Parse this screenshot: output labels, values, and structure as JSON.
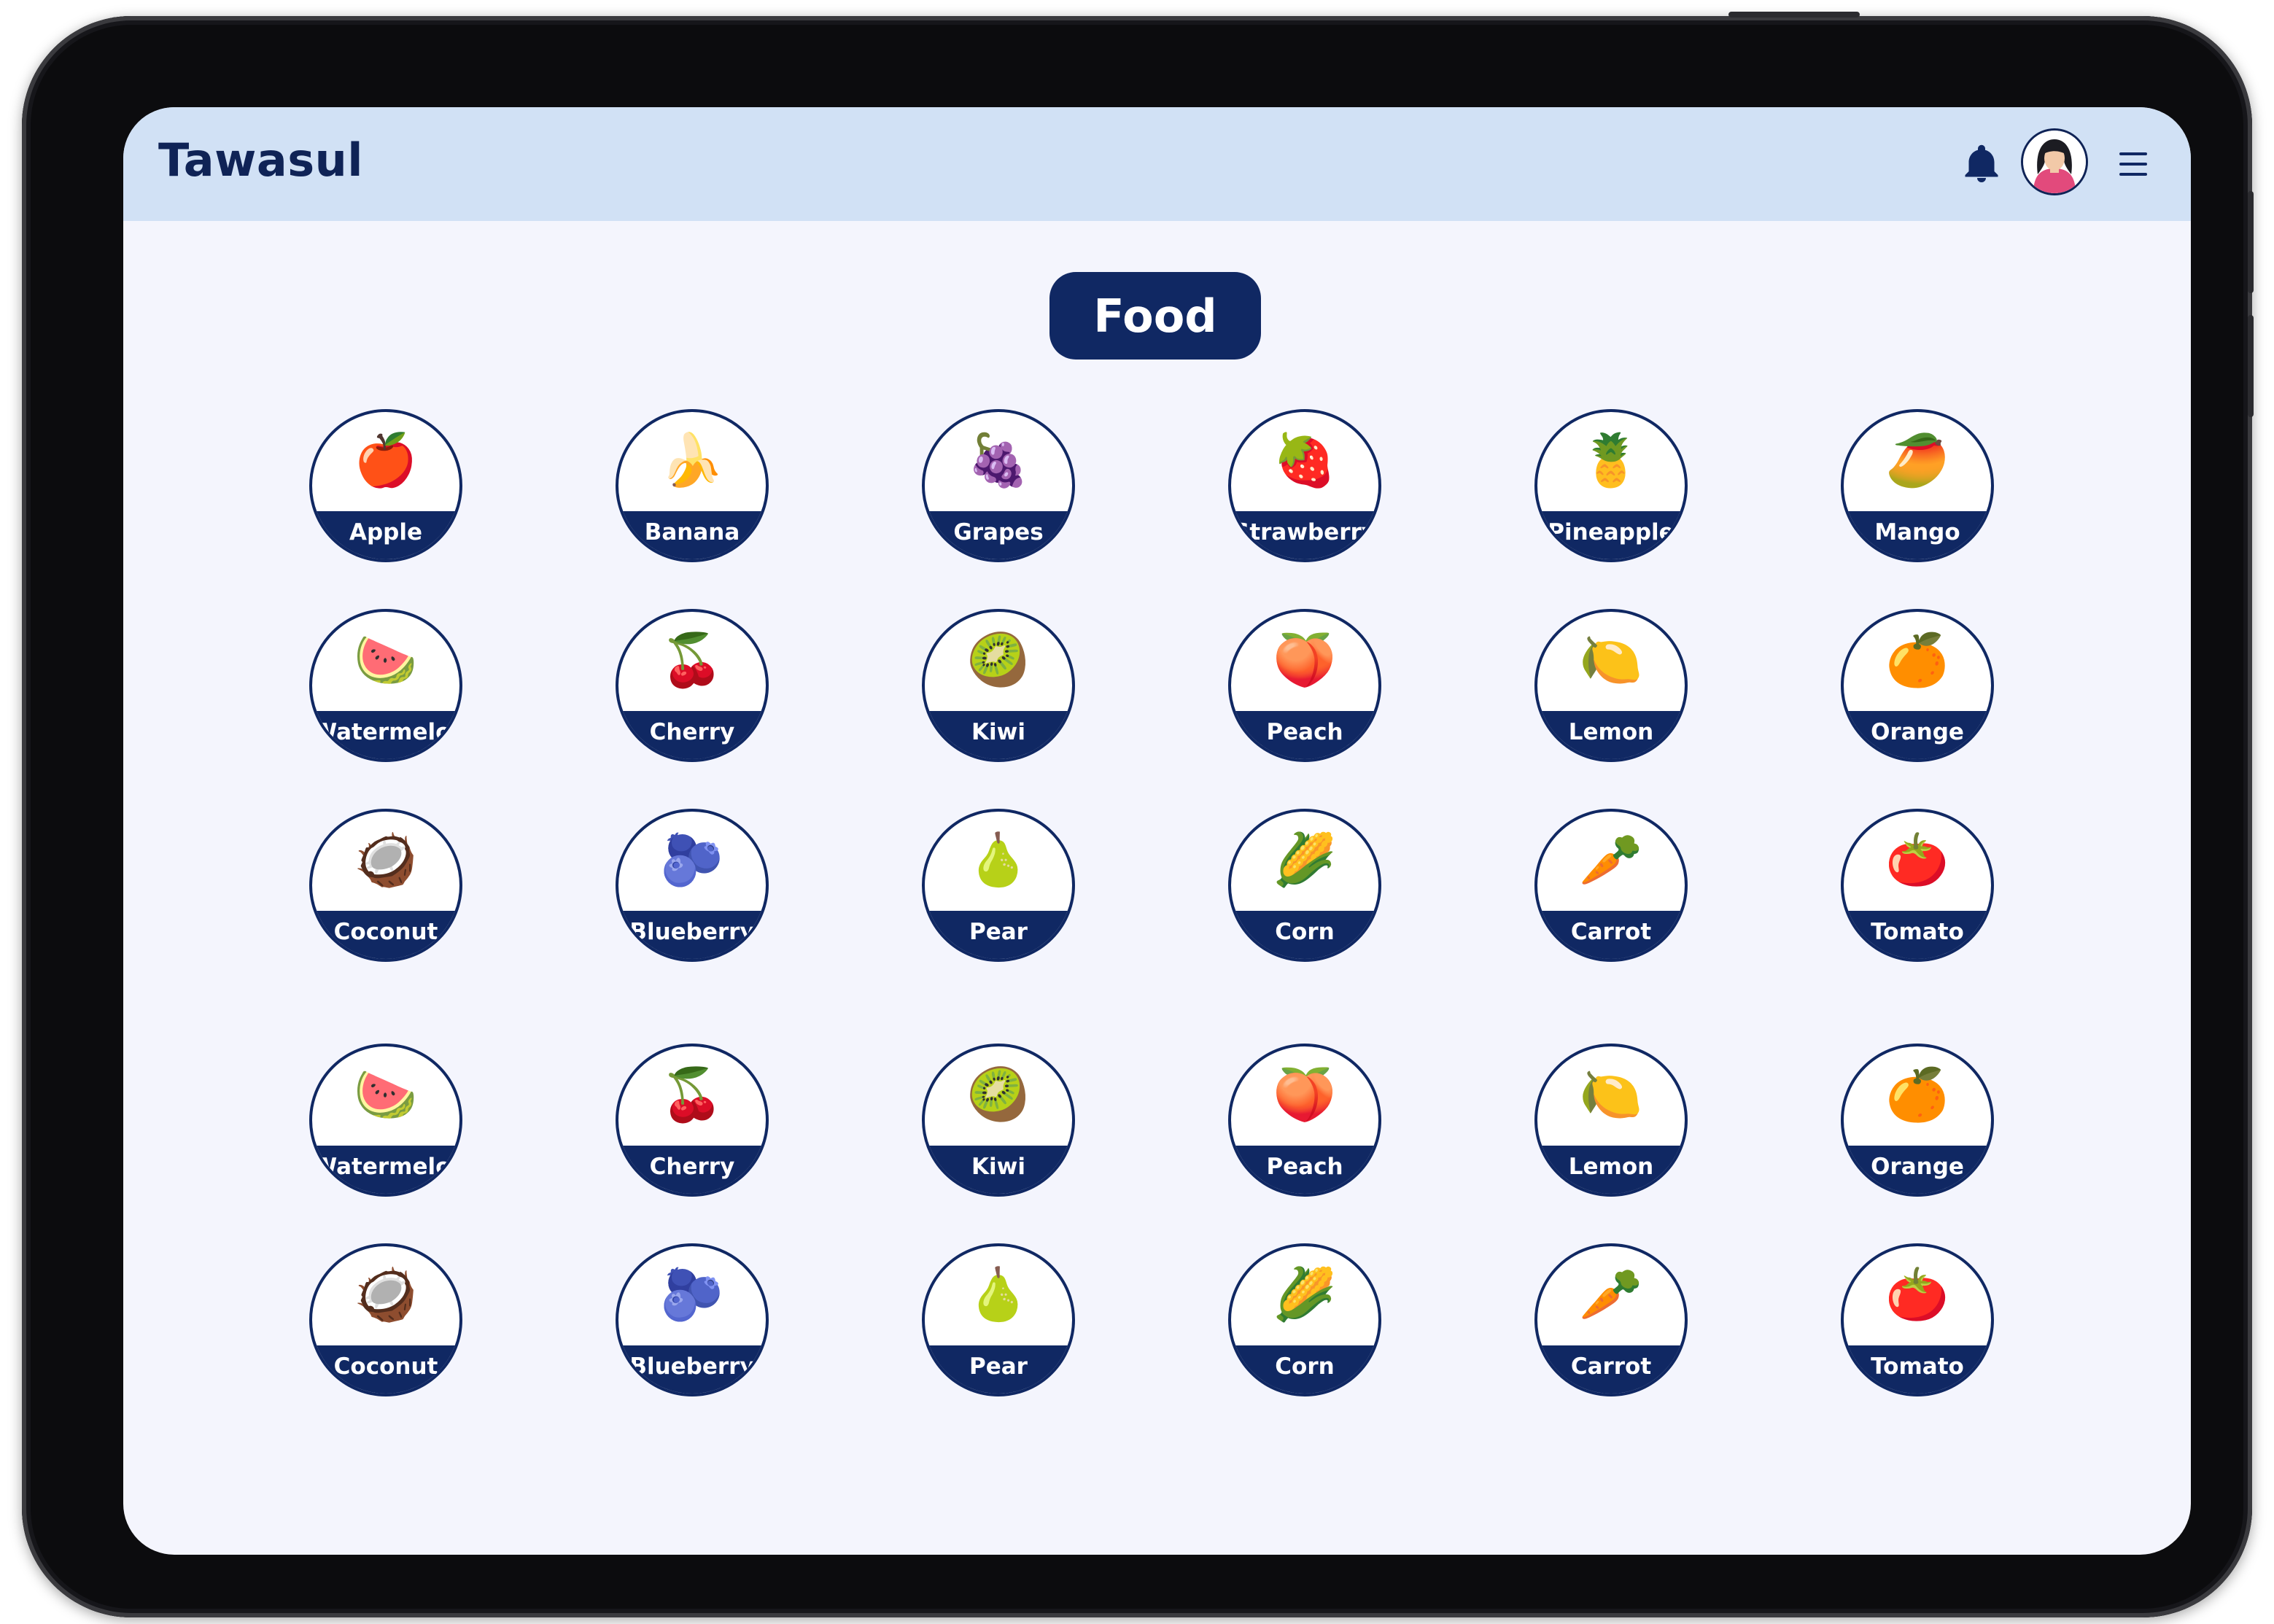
{
  "app": {
    "title": "Tawasul"
  },
  "header": {
    "icons": {
      "notifications": "bell-icon",
      "profile": "user-avatar",
      "menu": "hamburger-menu-icon"
    }
  },
  "page": {
    "title": "Food"
  },
  "colors": {
    "primary": "#102863",
    "header_bg": "#d1e1f5",
    "screen_bg": "#f4f5fd"
  },
  "items": [
    {
      "label": "Apple",
      "emoji": "🍎"
    },
    {
      "label": "Banana",
      "emoji": "🍌"
    },
    {
      "label": "Grapes",
      "emoji": "🍇"
    },
    {
      "label": "Strawberry",
      "emoji": "🍓"
    },
    {
      "label": "Pineapple",
      "emoji": "🍍"
    },
    {
      "label": "Mango",
      "emoji": "🥭"
    },
    {
      "label": "Watermelon",
      "emoji": "🍉"
    },
    {
      "label": "Cherry",
      "emoji": "🍒"
    },
    {
      "label": "Kiwi",
      "emoji": "🥝"
    },
    {
      "label": "Peach",
      "emoji": "🍑"
    },
    {
      "label": "Lemon",
      "emoji": "🍋"
    },
    {
      "label": "Orange",
      "emoji": "🍊"
    },
    {
      "label": "Coconut",
      "emoji": "🥥"
    },
    {
      "label": "Blueberry",
      "emoji": "🫐"
    },
    {
      "label": "Pear",
      "emoji": "🍐"
    },
    {
      "label": "Corn",
      "emoji": "🌽"
    },
    {
      "label": "Carrot",
      "emoji": "🥕"
    },
    {
      "label": "Tomato",
      "emoji": "🍅"
    },
    {
      "label": "Watermelon",
      "emoji": "🍉"
    },
    {
      "label": "Cherry",
      "emoji": "🍒"
    },
    {
      "label": "Kiwi",
      "emoji": "🥝"
    },
    {
      "label": "Peach",
      "emoji": "🍑"
    },
    {
      "label": "Lemon",
      "emoji": "🍋"
    },
    {
      "label": "Orange",
      "emoji": "🍊"
    },
    {
      "label": "Coconut",
      "emoji": "🥥"
    },
    {
      "label": "Blueberry",
      "emoji": "🫐"
    },
    {
      "label": "Pear",
      "emoji": "🍐"
    },
    {
      "label": "Corn",
      "emoji": "🌽"
    },
    {
      "label": "Carrot",
      "emoji": "🥕"
    },
    {
      "label": "Tomato",
      "emoji": "🍅"
    }
  ]
}
